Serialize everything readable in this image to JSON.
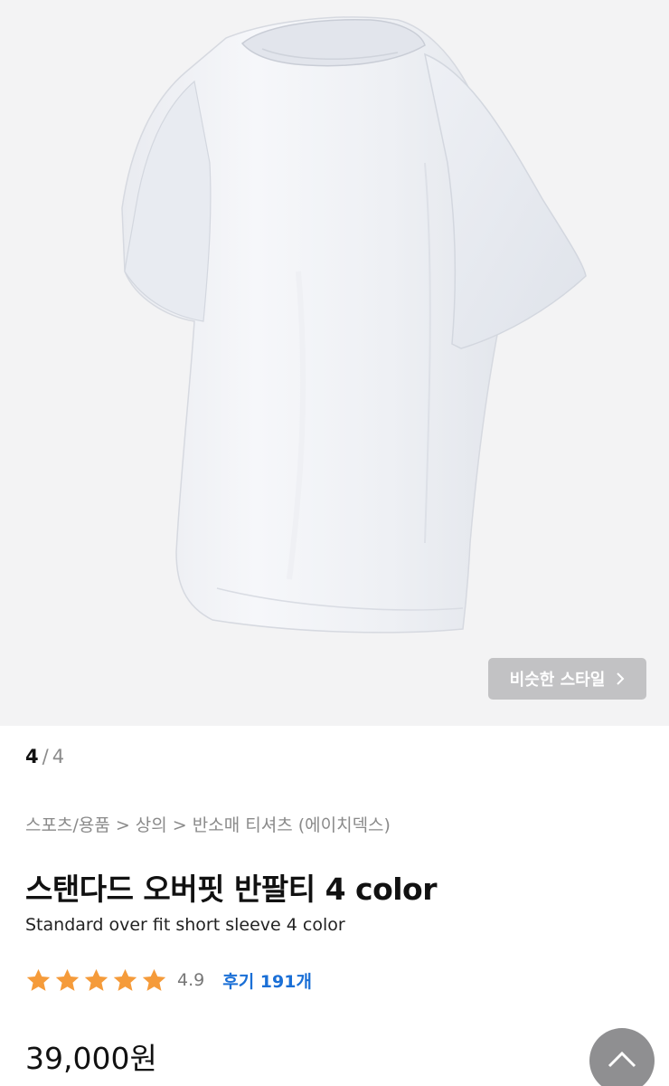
{
  "gallery": {
    "current_page": "4",
    "separator": "/",
    "total_pages": "4",
    "similar_style_label": "비슷한 스타일"
  },
  "product": {
    "breadcrumb": "스포츠/용품 > 상의 > 반소매 티셔츠 (에이치덱스)",
    "title": "스탠다드 오버핏 반팔티 4 color",
    "subtitle": "Standard over fit short sleeve 4 color",
    "rating": "4.9",
    "rating_stars": 5,
    "reviews_label": "후기 191개",
    "price": "39,000원"
  },
  "icons": {
    "similar_arrow": "chevron-right-icon",
    "scroll_top": "chevron-up-icon",
    "star": "star-icon"
  },
  "colors": {
    "star": "#f59b3a",
    "review_link": "#1a6fd6",
    "hero_bg": "#f3f3f4",
    "button_bg": "#c2c2c4",
    "top_button_bg": "#8f8f91"
  }
}
